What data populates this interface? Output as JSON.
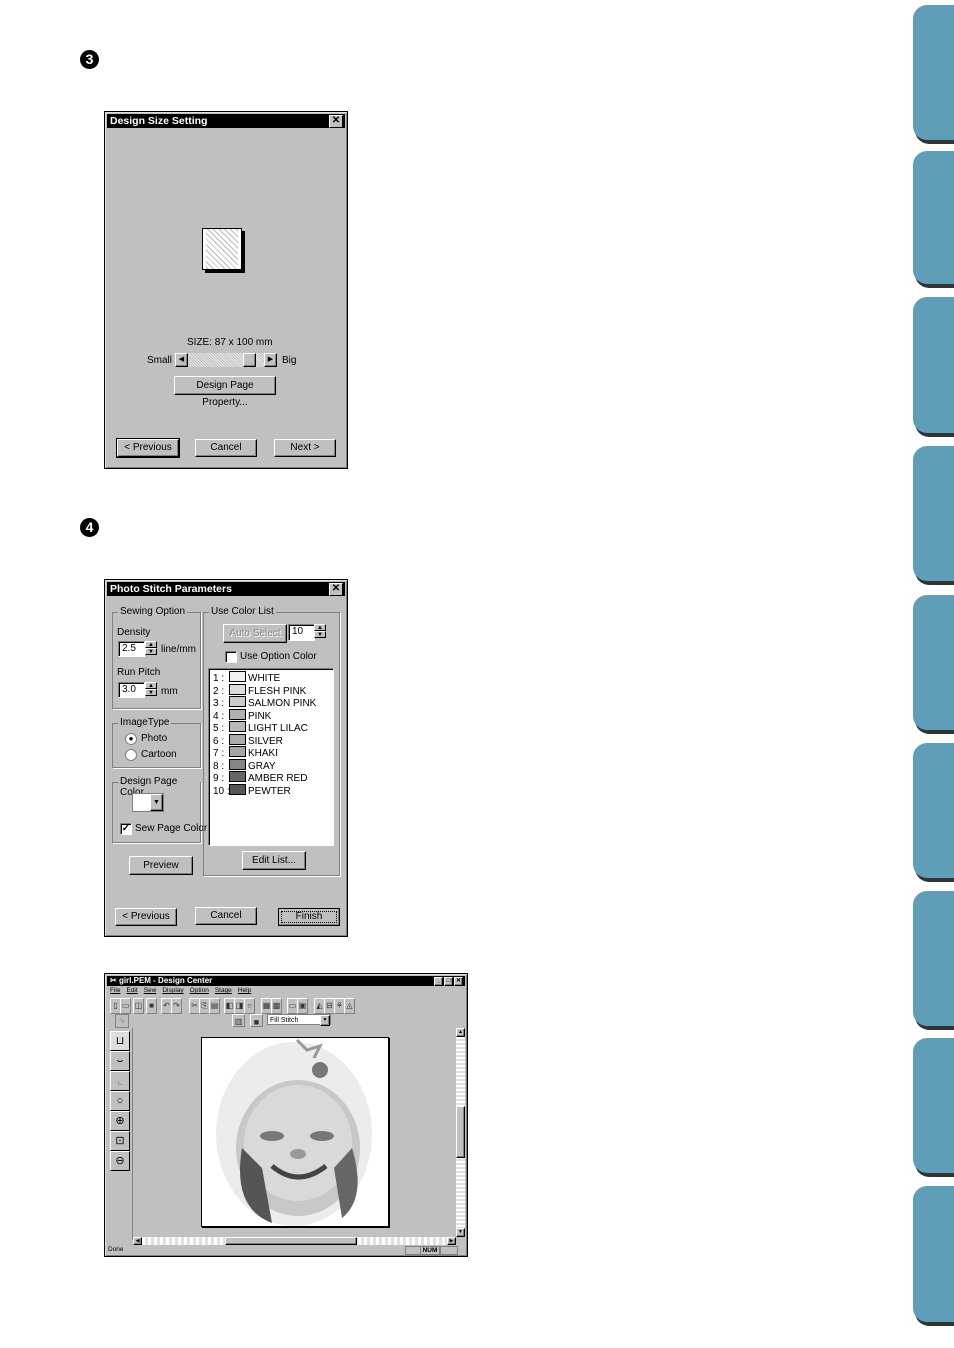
{
  "steps": [
    "3",
    "4"
  ],
  "side_tabs": {
    "color": "#5f9db8",
    "count": 9
  },
  "design_size_dialog": {
    "title": "Design Size Setting",
    "close_icon": "close-icon",
    "size_label": "SIZE:  87 x 100 mm",
    "slider_min_label": "Small",
    "slider_max_label": "Big",
    "slider_value_fraction": 0.85,
    "page_property_button": "Design Page Property...",
    "previous_button": "< Previous",
    "cancel_button": "Cancel",
    "next_button": "Next >"
  },
  "photo_stitch_dialog": {
    "title": "Photo Stitch Parameters",
    "sewing_option": {
      "group_title": "Sewing Option",
      "density_label": "Density",
      "density_value": "2.5",
      "density_unit": "line/mm",
      "run_pitch_label": "Run Pitch",
      "run_pitch_value": "3.0",
      "run_pitch_unit": "mm"
    },
    "image_type": {
      "group_title": "ImageType",
      "options": [
        "Photo",
        "Cartoon"
      ],
      "selected": "Photo"
    },
    "design_page_color": {
      "group_title": "Design Page Color",
      "swatch_color": "#ffffff",
      "sew_page_color_label": "Sew Page Color",
      "sew_page_color_checked": true
    },
    "preview_button": "Preview",
    "color_list": {
      "group_title": "Use Color List",
      "auto_select_button": "Auto Select",
      "count_value": "10",
      "use_option_color_label": "Use Option Color",
      "use_option_color_checked": false,
      "items": [
        {
          "num": "1 :",
          "name": "WHITE",
          "color": "#f0f0f0"
        },
        {
          "num": "2 :",
          "name": "FLESH PINK",
          "color": "#dcdcdc"
        },
        {
          "num": "3 :",
          "name": "SALMON PINK",
          "color": "#cccccc"
        },
        {
          "num": "4 :",
          "name": "PINK",
          "color": "#b0b0b0"
        },
        {
          "num": "5 :",
          "name": "LIGHT LILAC",
          "color": "#b8b8b8"
        },
        {
          "num": "6 :",
          "name": "SILVER",
          "color": "#ababab"
        },
        {
          "num": "7 :",
          "name": "KHAKI",
          "color": "#a5a5a5"
        },
        {
          "num": "8 :",
          "name": "GRAY",
          "color": "#858585"
        },
        {
          "num": "9 :",
          "name": "AMBER RED",
          "color": "#666666"
        },
        {
          "num": "10 :",
          "name": "PEWTER",
          "color": "#555555"
        }
      ],
      "edit_list_button": "Edit List..."
    },
    "previous_button": "< Previous",
    "cancel_button": "Cancel",
    "finish_button": "Finish"
  },
  "design_center": {
    "title": "girl.PEM - Design Center",
    "menu": [
      "File",
      "Edit",
      "Sew",
      "Display",
      "Option",
      "Stage",
      "Help"
    ],
    "stitch_type_value": "Fill Stitch",
    "status_text": "Done",
    "status_indicator": "NUM",
    "left_tools": [
      "select-tool-icon",
      "curve-tool-icon",
      "line-tool-icon",
      "circle-tool-icon",
      "zoom-in-icon",
      "zoom-area-icon",
      "zoom-out-icon"
    ]
  }
}
